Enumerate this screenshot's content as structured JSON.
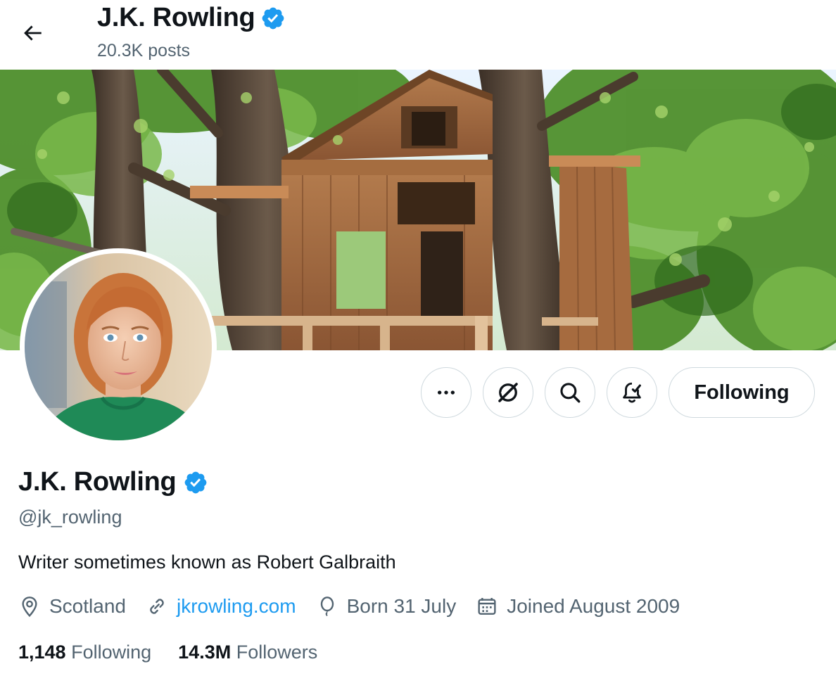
{
  "header": {
    "name": "J.K. Rowling",
    "posts": "20.3K posts"
  },
  "profile": {
    "name": "J.K. Rowling",
    "handle": "@jk_rowling",
    "bio": "Writer sometimes known as Robert Galbraith",
    "location": "Scotland",
    "website": "jkrowling.com",
    "birthday": "Born 31 July",
    "joined": "Joined August 2009",
    "following_count": "1,148",
    "following_label": "Following",
    "followers_count": "14.3M",
    "followers_label": "Followers",
    "verified": true
  },
  "actions": {
    "more_icon": "more-icon",
    "grok_icon": "grok-icon",
    "search_icon": "search-icon",
    "notifications_icon": "notification-bell-icon",
    "follow_label": "Following"
  },
  "colors": {
    "accent": "#1d9bf0",
    "text": "#0f1419",
    "secondary_text": "#536471",
    "border": "#cfd9de"
  }
}
